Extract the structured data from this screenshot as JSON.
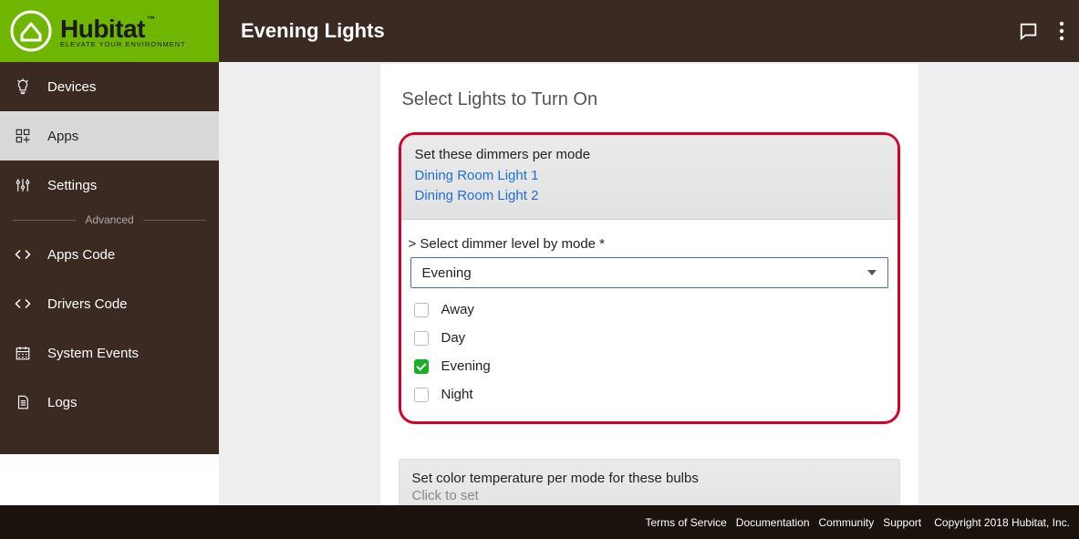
{
  "brand": {
    "name": "Hubitat",
    "tagline": "ELEVATE YOUR ENVIRONMENT"
  },
  "page_title": "Evening Lights",
  "sidebar": {
    "items": [
      {
        "label": "Devices"
      },
      {
        "label": "Apps"
      },
      {
        "label": "Settings"
      }
    ],
    "advanced_label": "Advanced",
    "advanced_items": [
      {
        "label": "Apps Code"
      },
      {
        "label": "Drivers Code"
      },
      {
        "label": "System Events"
      },
      {
        "label": "Logs"
      }
    ]
  },
  "main": {
    "section_title": "Select Lights to Turn On",
    "dimmer_panel": {
      "header": "Set these dimmers per mode",
      "links": [
        "Dining Room Light 1",
        "Dining Room Light 2"
      ]
    },
    "select_label": "> Select dimmer level by mode *",
    "select_value": "Evening",
    "options": [
      {
        "label": "Away",
        "checked": false
      },
      {
        "label": "Day",
        "checked": false
      },
      {
        "label": "Evening",
        "checked": true
      },
      {
        "label": "Night",
        "checked": false
      }
    ],
    "color_temp_panel": {
      "header": "Set color temperature per mode for these bulbs",
      "sub": "Click to set"
    }
  },
  "footer": {
    "links": [
      "Terms of Service",
      "Documentation",
      "Community",
      "Support"
    ],
    "copyright": "Copyright 2018 Hubitat, Inc."
  }
}
